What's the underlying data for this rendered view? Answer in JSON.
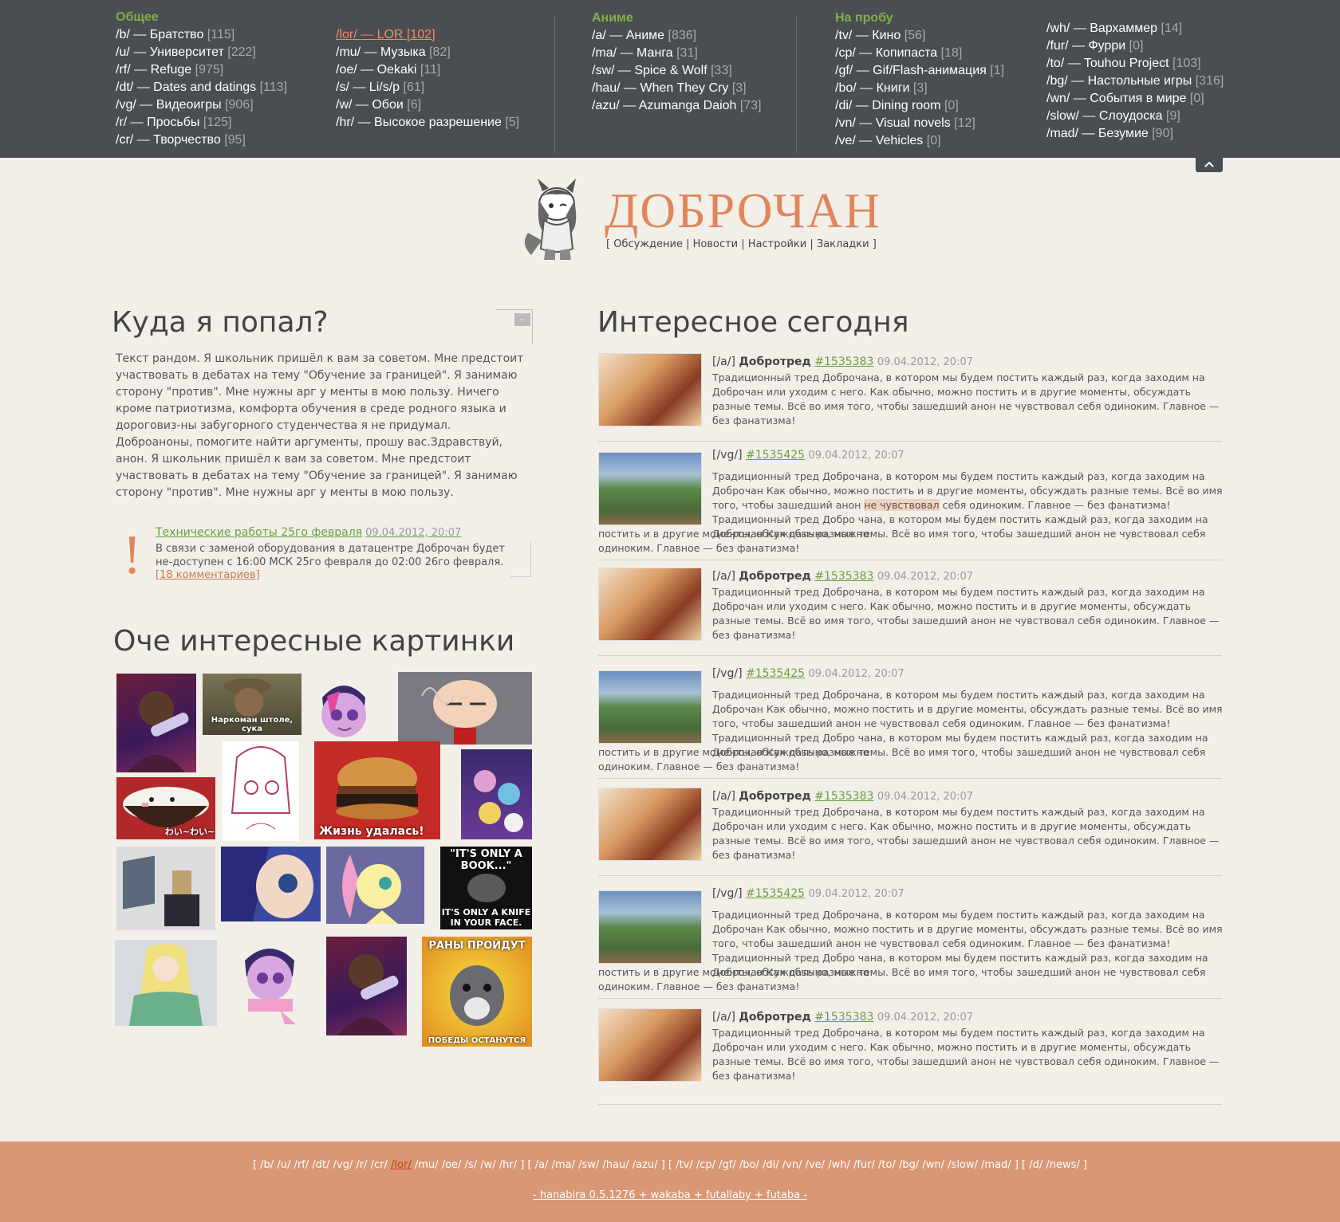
{
  "nav": {
    "groups": [
      {
        "title": "Общее",
        "boards": [
          {
            "code": "/b/",
            "name": "Братство",
            "count": "[115]"
          },
          {
            "code": "/u/",
            "name": "Университет",
            "count": "[222]"
          },
          {
            "code": "/rf/",
            "name": "Refuge",
            "count": "[975]"
          },
          {
            "code": "/dt/",
            "name": "Dates and datings",
            "count": "[113]"
          },
          {
            "code": "/vg/",
            "name": "Видеоигры",
            "count": "[906]"
          },
          {
            "code": "/r/",
            "name": "Просьбы",
            "count": "[125]"
          },
          {
            "code": "/cr/",
            "name": "Творчество",
            "count": "[95]"
          }
        ]
      },
      {
        "title": "",
        "boards": [
          {
            "code": "/lor/",
            "name": "LOR",
            "count": "[102]",
            "active": true
          },
          {
            "code": "/mu/",
            "name": "Музыка",
            "count": "[82]"
          },
          {
            "code": "/oe/",
            "name": "Oekaki",
            "count": "[11]"
          },
          {
            "code": "/s/",
            "name": "Li/s/p",
            "count": "[61]"
          },
          {
            "code": "/w/",
            "name": "Обои",
            "count": "[6]"
          },
          {
            "code": "/hr/",
            "name": "Высокое разрешение",
            "count": "[5]"
          }
        ]
      },
      {
        "title": "Аниме",
        "boards": [
          {
            "code": "/a/",
            "name": "Аниме",
            "count": "[836]"
          },
          {
            "code": "/ma/",
            "name": "Манга",
            "count": "[31]"
          },
          {
            "code": "/sw/",
            "name": "Spice & Wolf",
            "count": "[33]"
          },
          {
            "code": "/hau/",
            "name": "When They Cry",
            "count": "[3]"
          },
          {
            "code": "/azu/",
            "name": "Azumanga Daioh",
            "count": "[73]"
          }
        ]
      },
      {
        "title": "На пробу",
        "boards": [
          {
            "code": "/tv/",
            "name": "Кино",
            "count": "[56]"
          },
          {
            "code": "/cp/",
            "name": "Копипаста",
            "count": "[18]"
          },
          {
            "code": "/gf/",
            "name": "Gif/Flash-анимация",
            "count": "[1]"
          },
          {
            "code": "/bo/",
            "name": "Книги",
            "count": "[3]"
          },
          {
            "code": "/di/",
            "name": "Dining room",
            "count": "[0]"
          },
          {
            "code": "/vn/",
            "name": "Visual novels",
            "count": "[12]"
          },
          {
            "code": "/ve/",
            "name": "Vehicles",
            "count": "[0]"
          }
        ]
      },
      {
        "title": "",
        "boards": [
          {
            "code": "/wh/",
            "name": "Вархаммер",
            "count": "[14]"
          },
          {
            "code": "/fur/",
            "name": "Фурри",
            "count": "[0]"
          },
          {
            "code": "/to/",
            "name": "Touhou Project",
            "count": "[103]"
          },
          {
            "code": "/bg/",
            "name": "Настольные игры",
            "count": "[316]"
          },
          {
            "code": "/wn/",
            "name": "События в мире",
            "count": "[0]"
          },
          {
            "code": "/slow/",
            "name": "Слоудоска",
            "count": "[9]"
          },
          {
            "code": "/mad/",
            "name": "Безумие",
            "count": "[90]"
          }
        ]
      }
    ],
    "dash": "—",
    "collapse_icon": "chevron-up-icon"
  },
  "header": {
    "title": "ДОБРОЧАН",
    "links_open": "[",
    "links": [
      "Обсуждение",
      "Новости",
      "Настройки",
      "Закладки"
    ],
    "links_close": "]",
    "mascot": "wolf-girl-mascot"
  },
  "intro": {
    "title": "Куда я попал?",
    "minimize_label": "–",
    "text": "Текст рандом. Я школьник пришёл к вам за советом. Мне предстоит участвовать в дебатах на тему \"Обучение за границей\". Я занимаю сторону \"против\". Мне нужны арг у менты в мою пользу. Ничего кроме патриотизма, комфорта обучения в среде родного языка и дороговиз-ны забугорного студенчества я не придумал.",
    "text2": "Доброаноны, помогите найти аргументы, прошу вас.Здравствуй, анон. Я школьник пришёл к вам за советом. Мне предстоит участвовать в дебатах на тему \"Обучение за границей\". Я занимаю сторону \"против\". Мне нужны арг у менты в мою пользу."
  },
  "news": {
    "icon": "!",
    "title": "Технические работы 25го февраля",
    "date": "09.04.2012, 20:07",
    "text": "В связи с заменой оборудования в датацентре Доброчан будет не-доступен с 16:00 МСК 25го февраля до 02:00 26го февраля.",
    "comments": "[18 комментариев]"
  },
  "gallery": {
    "title": "Оче интересные картинки",
    "captions": {
      "p2": "Наркоман штоле, сука",
      "p7": "Жизнь удалась!",
      "p9": "わい~わい~",
      "p14a": "\"IT'S ONLY A BOOK...\"",
      "p14b": "IT'S ONLY A KNIFE IN YOUR FACE.",
      "p18a": "РАНЫ ПРОЙДУТ",
      "p18b": "ПОБЕДЫ ОСТАНУТСЯ"
    }
  },
  "feed": {
    "title": "Интересное сегодня",
    "posts": [
      {
        "board": "[/a/]",
        "subject": "Добротред",
        "num": "#1535383",
        "date": "09.04.2012, 20:07",
        "text": "Традиционный тред Доброчана, в котором мы будем постить каждый раз, когда заходим на Доброчан или уходим с него. Как обычно, можно постить и в другие моменты, обсуждать разные темы. Всё во имя того, чтобы зашедший анон не чувствовал себя одиноким. Главное — без фанатизма!"
      },
      {
        "board": "[/vg/]",
        "subject": "",
        "num": "#1535425",
        "date": "09.04.2012, 20:07",
        "text_a": "Традиционный тред Доброчана, в котором мы будем постить каждый раз, когда заходим на Доброчан Как обычно, можно постить и в другие моменты, обсуждать разные темы. Всё во имя того, чтобы зашедший анон ",
        "text_hl": "не чувствовал",
        "text_b": " себя одиноким. Главное — без фанатизма! Традиционный тред Добро чана, в котором мы будем постить каждый раз, когда заходим на Доброчан Как обычно, можно",
        "text_c": "постить и в другие моменты, обсуждать разные темы. Всё во имя того, чтобы зашедший анон не чувствовал себя одиноким. Главное — без фанатизма!"
      },
      {
        "board": "[/a/]",
        "subject": "Добротред",
        "num": "#1535383",
        "date": "09.04.2012, 20:07",
        "text": "Традиционный тред Доброчана, в котором мы будем постить каждый раз, когда заходим на Доброчан или уходим с него. Как обычно, можно постить и в другие моменты, обсуждать разные темы. Всё во имя того, чтобы зашедший анон не чувствовал себя одиноким. Главное — без фанатизма!"
      },
      {
        "board": "[/vg/]",
        "subject": "",
        "num": "#1535425",
        "date": "09.04.2012, 20:07",
        "text_a": "Традиционный тред Доброчана, в котором мы будем постить каждый раз, когда заходим на Доброчан Как обычно, можно постить и в другие моменты, обсуждать разные темы. Всё во имя того, чтобы зашедший анон не чувствовал себя одиноким. Главное — без фанатизма! Традиционный тред Добро чана, в котором мы будем постить каждый раз, когда заходим на Доброчан Как обычно, можно",
        "text_c": "постить и в другие моменты, обсуждать разные темы. Всё во имя того, чтобы зашедший анон не чувствовал себя одиноким. Главное — без фанатизма!"
      },
      {
        "board": "[/a/]",
        "subject": "Добротред",
        "num": "#1535383",
        "date": "09.04.2012, 20:07",
        "text": "Традиционный тред Доброчана, в котором мы будем постить каждый раз, когда заходим на Доброчан или уходим с него. Как обычно, можно постить и в другие моменты, обсуждать разные темы. Всё во имя того, чтобы зашедший анон не чувствовал себя одиноким. Главное — без фанатизма!"
      },
      {
        "board": "[/vg/]",
        "subject": "",
        "num": "#1535425",
        "date": "09.04.2012, 20:07",
        "text_a": "Традиционный тред Доброчана, в котором мы будем постить каждый раз, когда заходим на Доброчан Как обычно, можно постить и в другие моменты, обсуждать разные темы. Всё во имя того, чтобы зашедший анон не чувствовал себя одиноким. Главное — без фанатизма! Традиционный тред Добро чана, в котором мы будем постить каждый раз, когда заходим на Доброчан Как обычно, можно",
        "text_c": "постить и в другие моменты, обсуждать разные темы. Всё во имя того, чтобы зашедший анон не чувствовал себя одиноким. Главное — без фанатизма!"
      },
      {
        "board": "[/a/]",
        "subject": "Добротред",
        "num": "#1535383",
        "date": "09.04.2012, 20:07",
        "text": "Традиционный тред Доброчана, в котором мы будем постить каждый раз, когда заходим на Доброчан или уходим с него. Как обычно, можно постить и в другие моменты, обсуждать разные темы. Всё во имя того, чтобы зашедший анон не чувствовал себя одиноким. Главное — без фанатизма!"
      }
    ]
  },
  "footer": {
    "groups": [
      [
        "/b/",
        "/u/",
        "/rf/",
        "/dt/",
        "/vg/",
        "/r/",
        "/cr/",
        "/lor/",
        "/mu/",
        "/oe/",
        "/s/",
        "/w/",
        "/hr/"
      ],
      [
        "/a/",
        "/ma/",
        "/sw/",
        "/hau/",
        "/azu/"
      ],
      [
        "/tv/",
        "/cp/",
        "/gf/",
        "/bo/",
        "/di/",
        "/vn/",
        "/ve/",
        "/wh/",
        "/fur/",
        "/to/",
        "/bg/",
        "/wn/",
        "/slow/",
        "/mad/"
      ],
      [
        "/d/",
        "/news/"
      ]
    ],
    "active": "/lor/",
    "version": "- hanabira 0.5.1276 + wakaba + futallaby + futaba -"
  },
  "colors": {
    "accent": "#e0855c",
    "nav_bg": "#4a4d52",
    "green": "#7fb04e",
    "footer_bg": "#d99875",
    "page_bg": "#f2efe9"
  }
}
